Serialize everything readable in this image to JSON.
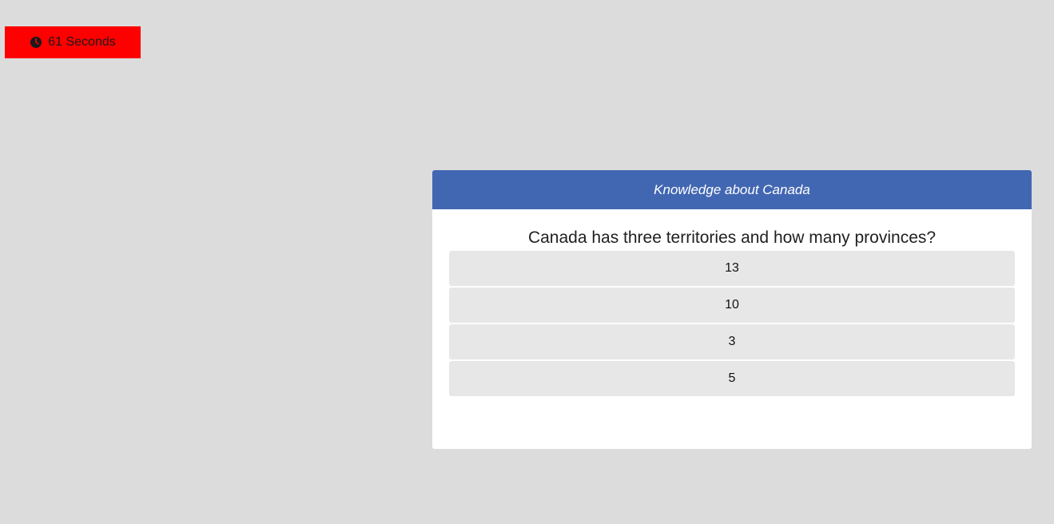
{
  "timer": {
    "icon": "clock-icon",
    "label": "61 Seconds",
    "background": "#ff0000"
  },
  "quiz": {
    "title": "Knowledge about Canada",
    "header_color": "#4267b2",
    "question": "Canada has three territories and how many provinces?",
    "answers": [
      {
        "label": "13"
      },
      {
        "label": "10"
      },
      {
        "label": "3"
      },
      {
        "label": "5"
      }
    ]
  }
}
